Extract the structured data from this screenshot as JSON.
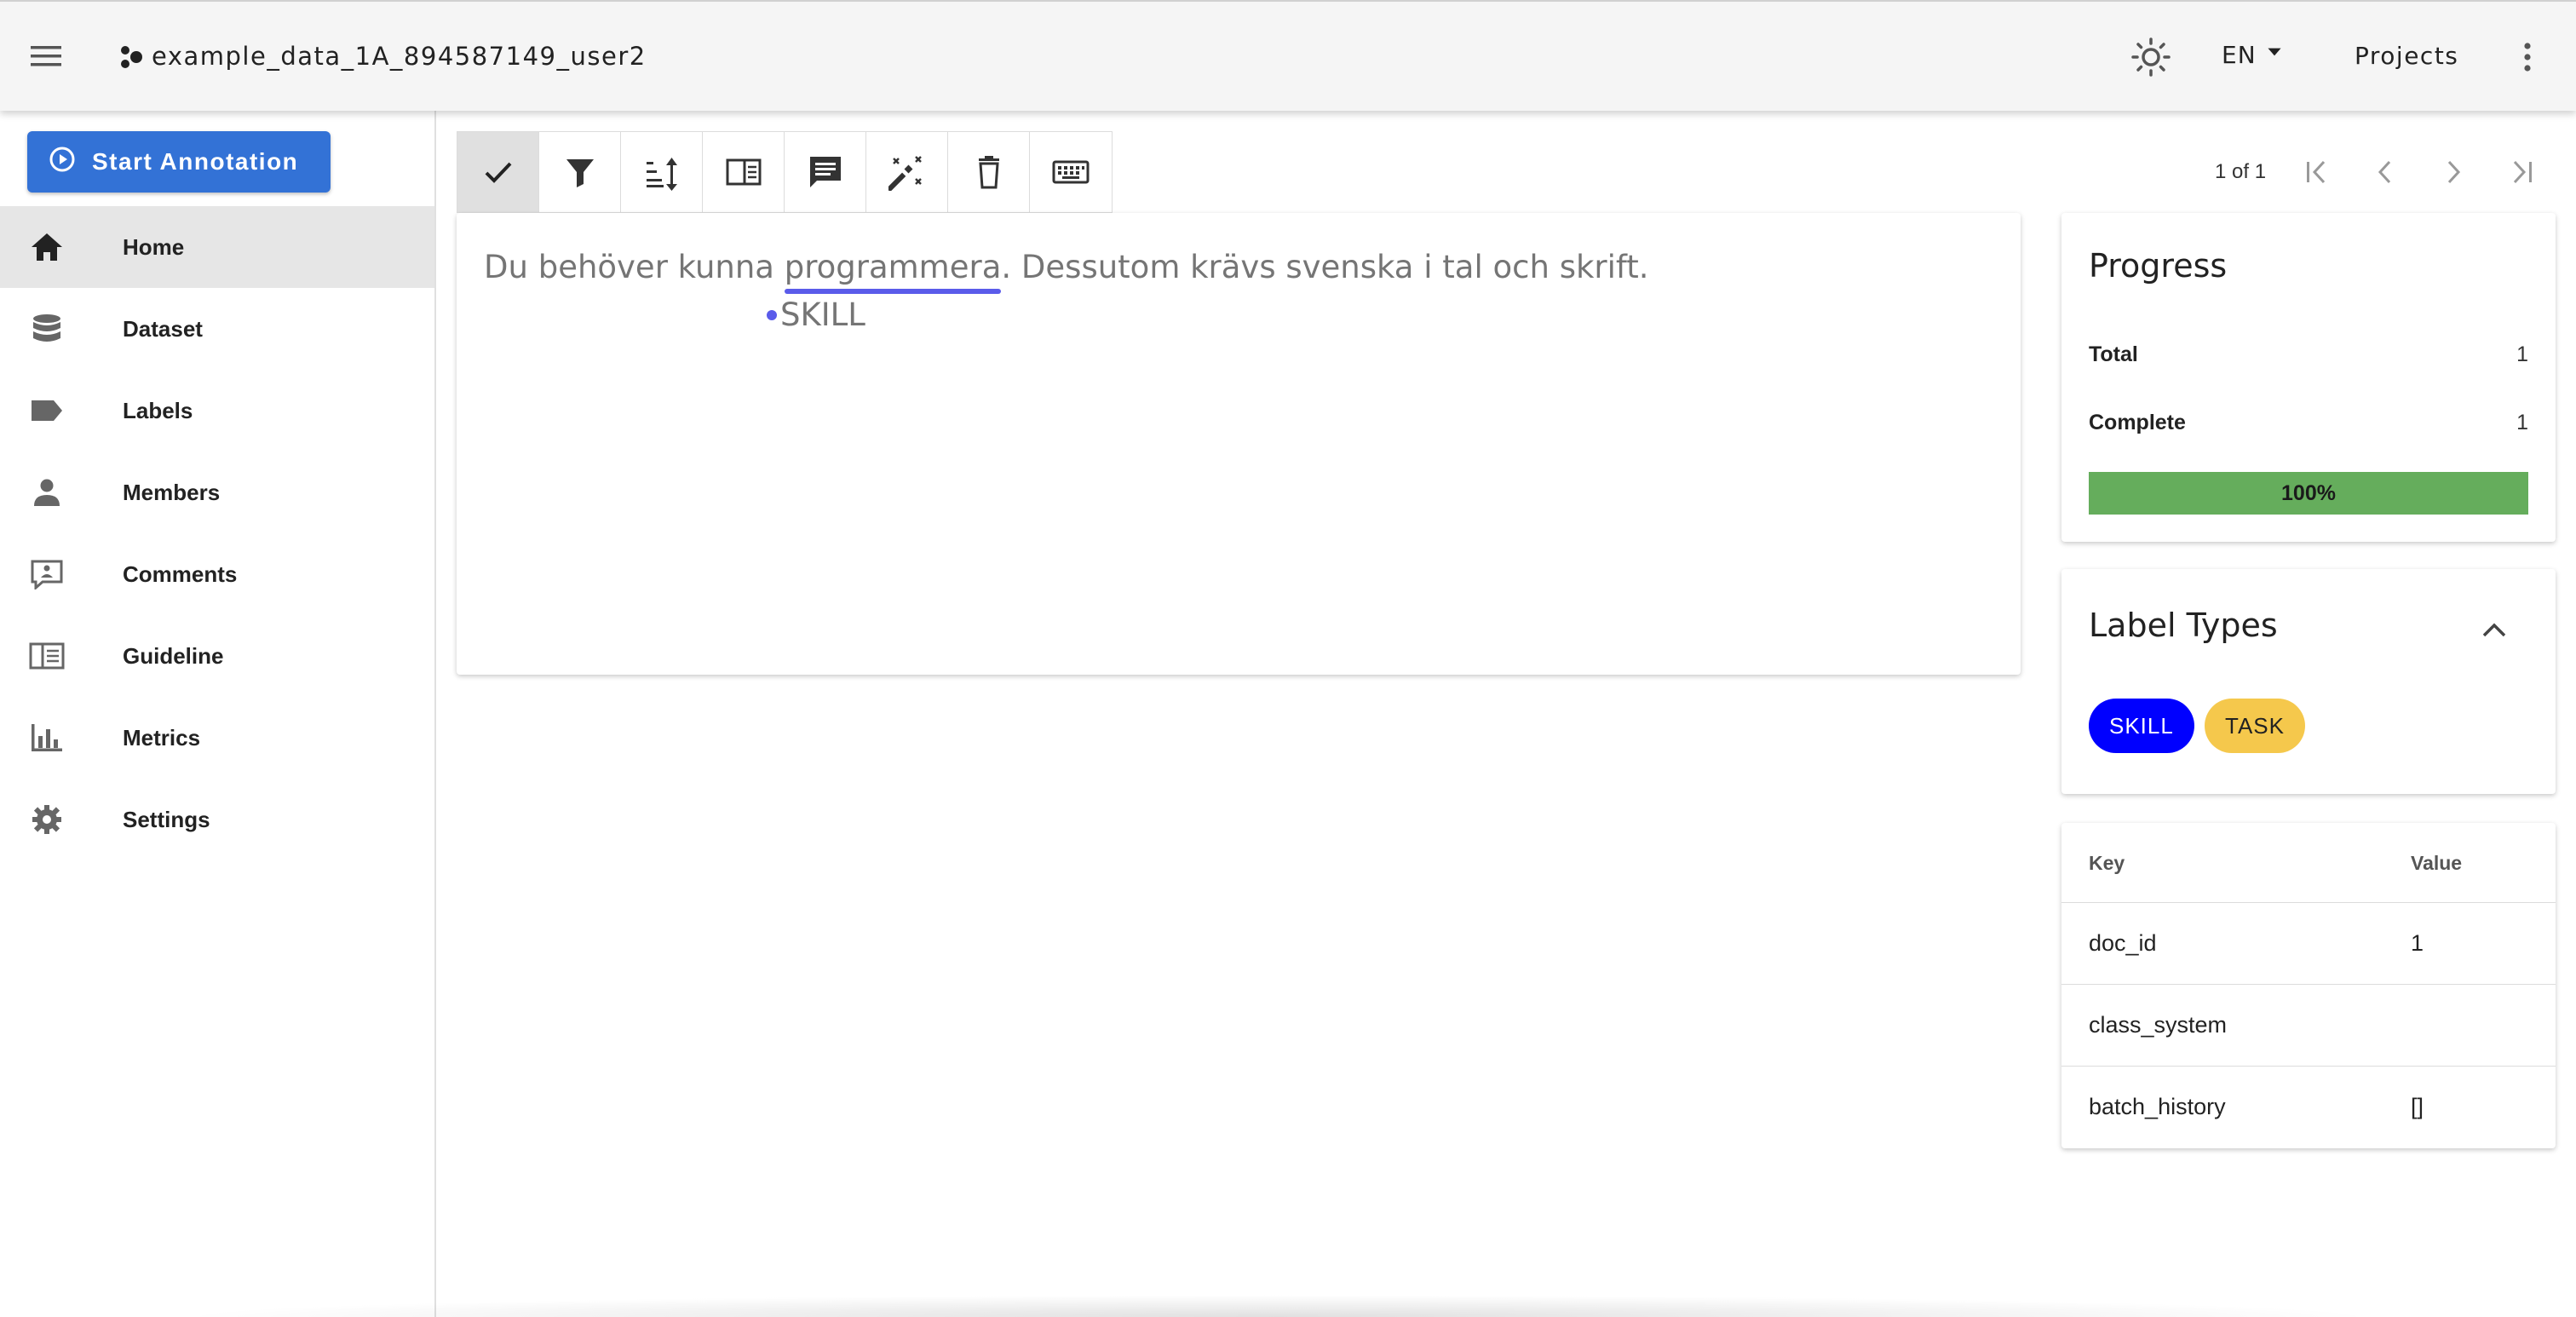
{
  "appbar": {
    "project_name": "example_data_1A_894587149_user2",
    "language": "EN",
    "projects_label": "Projects"
  },
  "sidebar": {
    "start_label": "Start Annotation",
    "items": [
      {
        "label": "Home",
        "icon": "home-icon"
      },
      {
        "label": "Dataset",
        "icon": "database-icon"
      },
      {
        "label": "Labels",
        "icon": "label-icon"
      },
      {
        "label": "Members",
        "icon": "person-icon"
      },
      {
        "label": "Comments",
        "icon": "comment-icon"
      },
      {
        "label": "Guideline",
        "icon": "guideline-icon"
      },
      {
        "label": "Metrics",
        "icon": "bar-chart-icon"
      },
      {
        "label": "Settings",
        "icon": "gear-icon"
      }
    ]
  },
  "toolbar": {
    "tools": [
      "check-icon",
      "filter-icon",
      "sort-icon",
      "layout-icon",
      "comment-icon",
      "auto-label-icon",
      "delete-icon",
      "keyboard-icon"
    ]
  },
  "pager": {
    "count": "1 of 1"
  },
  "document": {
    "before": "Du behöver kunna ",
    "entity_text": "programmera",
    "after": ". Dessutom krävs svenska i tal och skrift.",
    "entity_label": "SKILL",
    "entity_color": "#5a5bea"
  },
  "progress": {
    "title": "Progress",
    "total_label": "Total",
    "total_value": "1",
    "complete_label": "Complete",
    "complete_value": "1",
    "percent_label": "100%",
    "percent": 1.0,
    "bar_color": "#65ad5c"
  },
  "label_types": {
    "title": "Label Types",
    "chips": [
      {
        "text": "SKILL",
        "bg": "#0000ff",
        "fg": "#ffffff"
      },
      {
        "text": "TASK",
        "bg": "#f5c84c",
        "fg": "#222222"
      }
    ]
  },
  "metadata": {
    "key_header": "Key",
    "value_header": "Value",
    "rows": [
      {
        "key": "doc_id",
        "value": "1"
      },
      {
        "key": "class_system",
        "value": ""
      },
      {
        "key": "batch_history",
        "value": "[]"
      }
    ]
  }
}
